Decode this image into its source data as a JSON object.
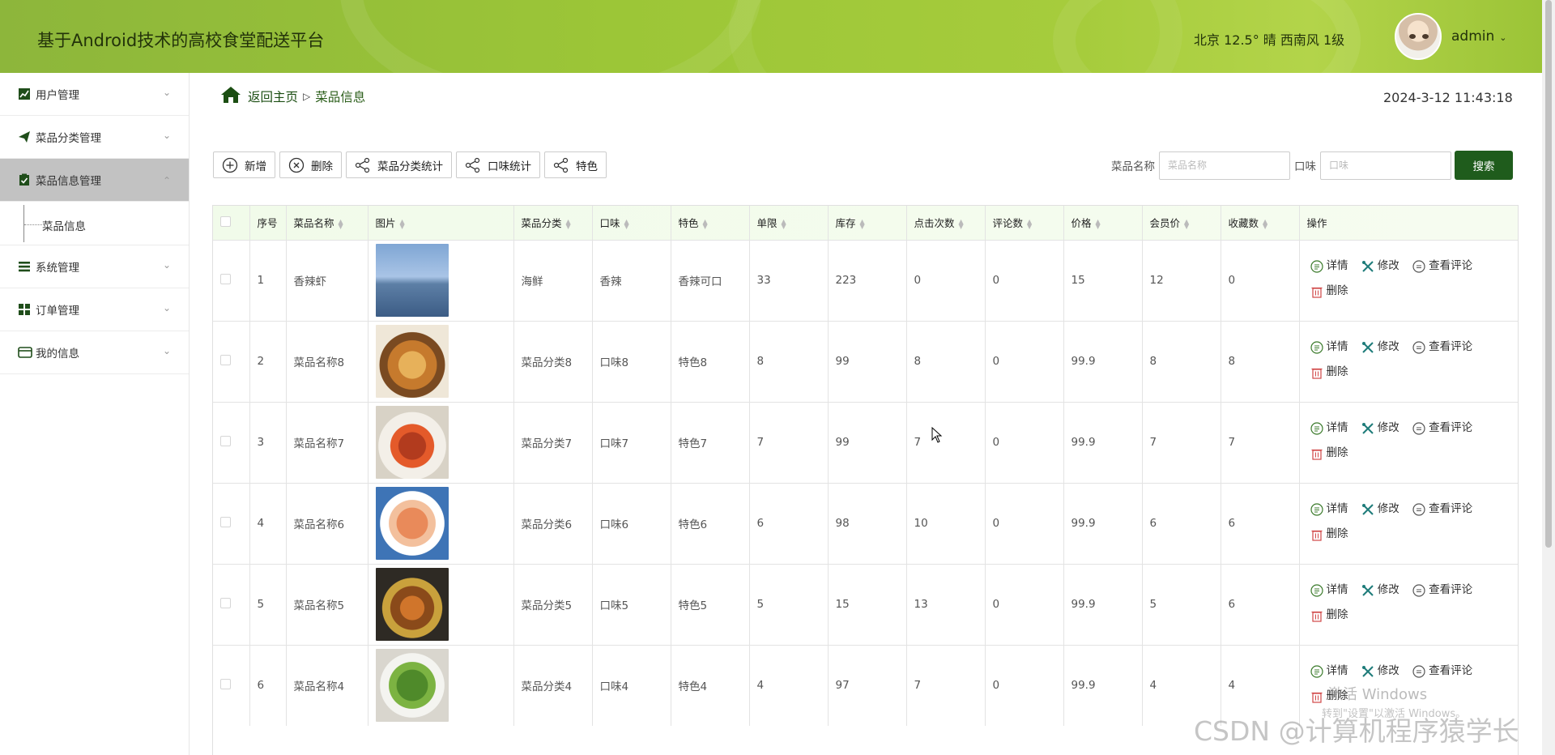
{
  "header": {
    "app_title": "基于Android技术的高校食堂配送平台",
    "weather": "北京  12.5°  晴  西南风  1级",
    "username": "admin"
  },
  "sidebar": {
    "items": [
      {
        "label": "用户管理",
        "icon": "chart-icon",
        "expanded": false
      },
      {
        "label": "菜品分类管理",
        "icon": "send-icon",
        "expanded": false
      },
      {
        "label": "菜品信息管理",
        "icon": "clipboard-check-icon",
        "expanded": true,
        "active": true,
        "children": [
          "菜品信息"
        ]
      },
      {
        "label": "系统管理",
        "icon": "list-icon",
        "expanded": false
      },
      {
        "label": "订单管理",
        "icon": "grid-icon",
        "expanded": false
      },
      {
        "label": "我的信息",
        "icon": "card-icon",
        "expanded": false
      }
    ]
  },
  "breadcrumb": {
    "home": "返回主页",
    "current": "菜品信息"
  },
  "clock": "2024-3-12 11:43:18",
  "toolbar": {
    "add": "新增",
    "delete": "删除",
    "category_stats": "菜品分类统计",
    "taste_stats": "口味统计",
    "feature": "特色"
  },
  "search": {
    "name_label": "菜品名称",
    "name_placeholder": "菜品名称",
    "taste_label": "口味",
    "taste_placeholder": "口味",
    "button": "搜索"
  },
  "table": {
    "columns": [
      "序号",
      "菜品名称",
      "图片",
      "菜品分类",
      "口味",
      "特色",
      "单限",
      "库存",
      "点击次数",
      "评论数",
      "价格",
      "会员价",
      "收藏数",
      "操作"
    ],
    "rows": [
      {
        "no": "1",
        "name": "香辣虾",
        "category": "海鲜",
        "taste": "香辣",
        "feature": "香辣可口",
        "limit": "33",
        "stock": "223",
        "clicks": "0",
        "comments": "0",
        "price": "15",
        "member_price": "12",
        "favorites": "0",
        "image": "bridge-photo"
      },
      {
        "no": "2",
        "name": "菜品名称8",
        "category": "菜品分类8",
        "taste": "口味8",
        "feature": "特色8",
        "limit": "8",
        "stock": "99",
        "clicks": "8",
        "comments": "0",
        "price": "99.9",
        "member_price": "8",
        "favorites": "8",
        "image": "salad-bowl-photo"
      },
      {
        "no": "3",
        "name": "菜品名称7",
        "category": "菜品分类7",
        "taste": "口味7",
        "feature": "特色7",
        "limit": "7",
        "stock": "99",
        "clicks": "7",
        "comments": "0",
        "price": "99.9",
        "member_price": "7",
        "favorites": "7",
        "image": "braised-pork-photo"
      },
      {
        "no": "4",
        "name": "菜品名称6",
        "category": "菜品分类6",
        "taste": "口味6",
        "feature": "特色6",
        "limit": "6",
        "stock": "98",
        "clicks": "10",
        "comments": "0",
        "price": "99.9",
        "member_price": "6",
        "favorites": "6",
        "image": "shrimp-plate-photo"
      },
      {
        "no": "5",
        "name": "菜品名称5",
        "category": "菜品分类5",
        "taste": "口味5",
        "feature": "特色5",
        "limit": "5",
        "stock": "15",
        "clicks": "13",
        "comments": "0",
        "price": "99.9",
        "member_price": "5",
        "favorites": "6",
        "image": "clay-pot-photo"
      },
      {
        "no": "6",
        "name": "菜品名称4",
        "category": "菜品分类4",
        "taste": "口味4",
        "feature": "特色4",
        "limit": "4",
        "stock": "97",
        "clicks": "7",
        "comments": "0",
        "price": "99.9",
        "member_price": "4",
        "favorites": "4",
        "image": "green-beans-photo"
      }
    ],
    "actions": {
      "detail": "详情",
      "edit": "修改",
      "view_comments": "查看评论",
      "delete": "删除"
    }
  },
  "overlays": {
    "windows_activate": "激活 Windows",
    "windows_activate_sub": "转到\"设置\"以激活 Windows。",
    "csdn_watermark": "CSDN @计算机程序猿学长"
  },
  "colors": {
    "header_green": "#9cc637",
    "button_green": "#1f5c1c",
    "active_menu": "#c2c2c2"
  }
}
